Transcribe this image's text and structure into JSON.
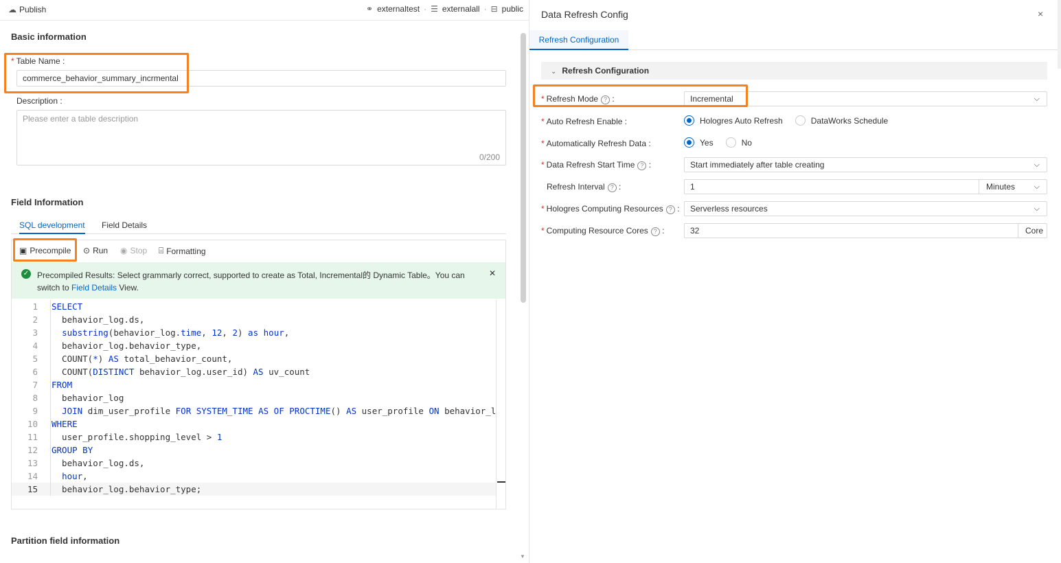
{
  "topbar": {
    "publish_label": "Publish",
    "crumbs": [
      "externaltest",
      "externalall",
      "public"
    ],
    "sep": "·"
  },
  "basic": {
    "section_title": "Basic information",
    "table_name_label": "Table Name :",
    "table_name_value": "commerce_behavior_summary_incrmental",
    "description_label": "Description :",
    "description_placeholder": "Please enter a table description",
    "description_count": "0/200"
  },
  "field_info": {
    "section_title": "Field Information",
    "tabs": [
      "SQL development",
      "Field Details"
    ],
    "toolbar": {
      "precompile": "Precompile",
      "run": "Run",
      "stop": "Stop",
      "formatting": "Formatting"
    },
    "result": {
      "text_before": "Precompiled Results: Select grammarly correct, supported to create as Total, Incremental的 Dynamic Table。You can switch to ",
      "link": "Field Details",
      "text_after": " View."
    }
  },
  "code_lines": [
    {
      "n": "1",
      "html": "<span class=\"kw\">SELECT</span>"
    },
    {
      "n": "2",
      "html": "  behavior_log.ds,"
    },
    {
      "n": "3",
      "html": "  <span class=\"fn\">substring</span>(behavior_log.<span class=\"kw\">time</span>, <span class=\"num\">12</span>, <span class=\"num\">2</span>) <span class=\"kw\">as</span> <span class=\"kw\">hour</span>,"
    },
    {
      "n": "4",
      "html": "  behavior_log.behavior_type,"
    },
    {
      "n": "5",
      "html": "  COUNT(<span class=\"kw\">*</span>) <span class=\"kw\">AS</span> total_behavior_count,"
    },
    {
      "n": "6",
      "html": "  COUNT(<span class=\"kw\">DISTINCT</span> behavior_log.user_id) <span class=\"kw\">AS</span> uv_count"
    },
    {
      "n": "7",
      "html": "<span class=\"kw\">FROM</span>"
    },
    {
      "n": "8",
      "html": "  behavior_log"
    },
    {
      "n": "9",
      "html": "  <span class=\"kw\">JOIN</span> dim_user_profile <span class=\"kw\">FOR</span> <span class=\"kw\">SYSTEM_TIME</span> <span class=\"kw\">AS</span> <span class=\"kw\">OF</span> <span class=\"kw\">PROCTIME</span>() <span class=\"kw\">AS</span> user_profile <span class=\"kw\">ON</span> behavior_l"
    },
    {
      "n": "10",
      "html": "<span class=\"kw\">WHERE</span>"
    },
    {
      "n": "11",
      "html": "  user_profile.shopping_level &gt; <span class=\"num\">1</span>"
    },
    {
      "n": "12",
      "html": "<span class=\"kw\">GROUP</span> <span class=\"kw\">BY</span>"
    },
    {
      "n": "13",
      "html": "  behavior_log.ds,"
    },
    {
      "n": "14",
      "html": "  <span class=\"kw\">hour</span>,"
    },
    {
      "n": "15",
      "html": "  behavior_log.behavior_type;"
    }
  ],
  "partition": {
    "section_title": "Partition field information"
  },
  "drawer": {
    "title": "Data Refresh Config",
    "close": "×",
    "tab": "Refresh Configuration",
    "panel_title": "Refresh Configuration",
    "fields": {
      "refresh_mode_label": "Refresh Mode",
      "refresh_mode_value": "Incremental",
      "auto_refresh_enable_label": "Auto Refresh Enable :",
      "auto_refresh_options": [
        "Hologres Auto Refresh",
        "DataWorks Schedule"
      ],
      "auto_refresh_selected": "Hologres Auto Refresh",
      "auto_refresh_data_label": "Automatically Refresh Data :",
      "auto_refresh_data_options": [
        "Yes",
        "No"
      ],
      "auto_refresh_data_selected": "Yes",
      "start_time_label": "Data Refresh Start Time",
      "start_time_value": "Start immediately after table creating",
      "interval_label": "Refresh Interval",
      "interval_value": "1",
      "interval_unit": "Minutes",
      "resources_label": "Hologres Computing Resources",
      "resources_value": "Serverless resources",
      "cores_label": "Computing Resource Cores",
      "cores_value": "32",
      "cores_unit": "Core"
    },
    "colon": ":"
  }
}
